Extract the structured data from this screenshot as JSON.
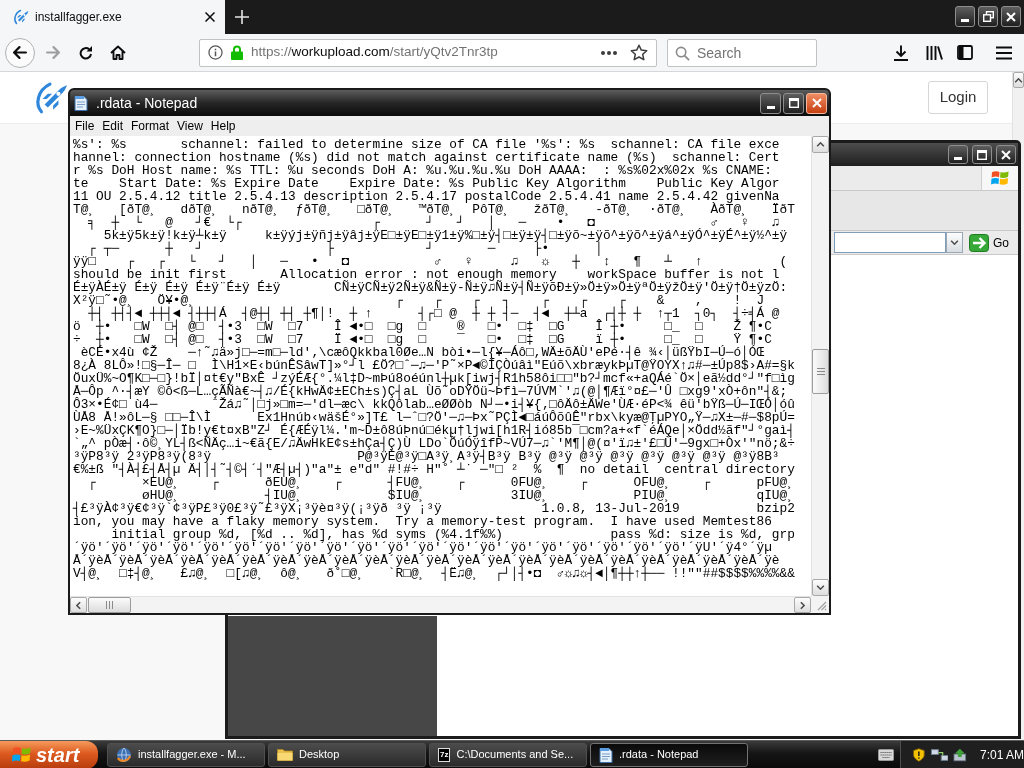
{
  "browser": {
    "tabs": [
      {
        "title": "installfagger.exe",
        "selected": true
      }
    ],
    "address": {
      "scheme": "https://",
      "host": "workupload.com",
      "path": "/start/yQtv2Tnr3tp"
    },
    "search": {
      "placeholder": "Search"
    }
  },
  "page": {
    "login_button": "Login"
  },
  "background_window": {
    "go_button": "Go"
  },
  "notepad": {
    "title": ".rdata - Notepad",
    "menu": [
      "File",
      "Edit",
      "Format",
      "View",
      "Help"
    ],
    "lines": [
      "%s': %s       schannel: failed to determine size of CA file '%s': %s  schannel: CA file exce",
      "hannel: connection hostname (%s) did not match against certificate name (%s)  schannel: Cert",
      "r %s DoH Host name: %s TTL: %u seconds DoH A: %u.%u.%u.%u DoH AAAA:  : %s%02x%02x %s CNAME:",
      "te    Start Date: %s Expire Date    Expire Date: %s Public Key Algorithm    Public Key Algor",
      "11 OU 2.5.4.12 title 2.5.4.13 description 2.5.4.17 postalCode 2.5.4.41 name 2.5.4.42 givenNa",
      "T@¸   [ðT@¸   dðT@¸   nðT@¸  ƒðT@¸   □ðT@¸   ™ðT@¸  PôT@¸   žðT@¸   -ðT@¸  ·ðT@¸   ÀðT@¸   ÏðT",
      "  ╕  ┼  └   @   ┘€  └┌                 ┌      ┘   ┘   │   ─    •   ◘               ♂   ♀   ♫",
      "    5k±ÿ5k±ÿ!k±ÿ┴k±ÿ     k±ÿýj±ÿñj±ÿâj±ÿE□±ÿE□±ÿ1±ÿ%□±ÿ┤□±ÿ±ÿ┤□±ÿõ~±ÿõ^±ÿõ^±ÿá^±ÿÓ^±ÿÉ^±ÿ½^±ÿ",
      "  ┌ ┬─      ┼   ┘                ├            ┘       ─     ├•      │",
      "ÿÿ□    ┌   ┌   └   ┘   │   ─   •   ◘           ♂   ♀     ♫   ☼   ┼   ↕   ¶   ┴   ↑          (",
      "should be init first       Allocation error : not enough memory    workSpace buffer is not l",
      "É±ÿÀÉ±ÿ É±ÿ É±ÿ É±ÿ¨É±ÿ É±ÿ       CÑ±ÿCÑ±ÿ2Ñ±ÿ&Ñ±ÿ-Ñ±ÿ♫Ñ±ÿ┤Ñ±ÿõÐ±ÿ»Ö±ÿ»Ö±ÿªÖ±ÿžÖ±ÿ'Ö±ÿ†Ö±ÿzÖ:",
      "X²ÿ□˜•@¸   Ö¥•@¸                          ┌    ┌    ┌   ┐    ┌    ┌    ┌    &    ,    !  J",
      "  ┼┤ ┼┤┤◄ ┼┼┤◄ ┤┼┼┤Á  ┤@┼┤ ┼┤ ┼¶│!  ┼ ↑      ┤┌□ @  ┼ ┼ ┤─  ┤◄  ┼┴a  ┌┤┼ ┼  ↑┬1  ┐0┐  ┤÷╡Á @",
      "ö  ┼•   □W  □┤ @□  ┤•3  □W  □7    Î ◄•□  □g  □    ®   □•  □‡  □G    Î ┼•     □_  □    Ž ¶•C",
      "÷  ┼•   □W  □┤ @□  ┤•3  □W  □7    Ï ◄•□  □g  □    ‾   □•  □‡  □G    ï ┼•     □_  □    Ÿ ¶•C",
      " èCÉ•x4ù ¢Ž    ─↑˜♫ä»j□─=m□─ld'‚\\cæôQkkbal0Øe…N bòi•─l{¥─Áô□,WÄ±õÄÙ'ePé·┤ê ¾‹│üßŸbI─Ú─ó│ÓŒ",
      "8¿À 8LÔ»!□§─Î─ □  Ì\\H1×E‹búnÊSâwT]»°┘l £Ö?□ˆ─♫─'P˜×P◄©ÌÇÒúâì\"Eúõ\\xbræykÞµT@ŸOYX↑♫#─±Úp8$›A#=§k",
      "ÖuxÜ%~O¶K□─□}!bÏ│¤t€y\"BxÊ ┘zýÉÆ{°.¼l‡D~mÞú8oéúnl┼µk[iwj┤R1h58ôi□□\"b?┘mcf«+aQÁé`Ö×│eã½dd°┘\"f□ìg",
      "Å─Ôp ^·┤æY ©ô<ß─L…çÃÑà€~┤♫/É{kHwÄ¢±ECh±s)Ç┤aL Ùõ˜oDŸÖü~Þfì─7ÚVM`'♫(@│¶Æï°¤£─'Û □xg9'xÒ+ôn\"┤&;",
      "Ô3×•É¢□ ù4─       ˆŽá♫˜│□j»□m=─'dl─æc\\ kkQôlab…eØØòb N┘─•i┤¥{‚□ôÄô±ÄWe'ÙÆ·éP<¾ êü'bŸß─Ú─IŒÓ│óû",
      "ÙÅ8 Å!»ôL─§ □□─Î\\Ì      Ex1Hnúb‹wäšÉ°»]T£ l─ˆ□?Ö'─♫─Þx˜PÇÌ◄□áúÔõûÊ\"rbx\\kyæ@ŢµPYO„Ÿ─♫X±─#─$8pÚ=",
      "›E~%ÜxÇK¶O}□─│Ïb!y€t¤xB\"Z┘ É{ÆÉÿl¼.'m~D±ô8úÞnú□ékµ†ljwi[h1R┤ió85b¯□cm?a+«f`éÁQe│×Ödd½ãf\"┘°gaì┤",
      "`„^ pÒæ┤·ô©¸YL┤ß<ÑÄç…i~€ã{E/♫ÄwHkE¢s±hÇa┤Ç)Ù LDo`ÕúÓÿîfP~VÚ7─♫`'M¶│@(¤'ï♫±'£□Ù'─9gx□+Òx'\"nö;&÷",
      "³ÿP8³ÿ 2³ÿP8³ÿ(8³ÿ                   P@³ÿÈ@³ÿ□A³ÿ¸A³ÿ┤B³ÿ B³ÿ @³ÿ @³ÿ @³ÿ @³ÿ @³ÿ @³ÿ @³ÿ8B³",
      "€%±ß \"┤À┤£┤Å┤µ Ä┤│┤˜┤©┤´┤\"Æ┤µ┤)\"a\"± e\"d\" #!#÷ H\"˚ ┴˙ ─\"□ ²  %  ¶  no detail  central directory",
      "  ┌      ×EU@¸    ┌      ðEU@¸    ┌      ┤FU@¸    ┌      0FU@¸    ┌      OFU@¸    ┌      pFU@¸",
      "         øHU@¸           ┤IU@¸           $IU@¸           3IU@¸           PIU@¸           qIU@¸",
      "┤£³ÿÀ¢³ÿ€¢³ÿ`¢³ÿP£³ÿ0£³ÿ˜£³ÿX¡³ÿè¤³ÿ(¡³ÿð ³ÿ ¡³ÿ             1.0.8, 13-Jul-2019          bzip2",
      "ion, you may have a flaky memory system.  Try a memory-test program.  I have used Memtest86",
      "     initial group %d, [%d .. %d], has %d syms (%4.1f%%)              pass %d: size is %d, grp",
      "´ÿö'´ÿö'´ÿö'´ÿö'´ÿö'´ÿö'´ÿö'´ÿö'´ÿö'´ÿö'´ÿö'´ÿö'´ÿö'´ÿö'´ÿö'´ÿö'´ÿö'´ÿö'´ÿö'´ÿö'´ÿU'´ÿ4°´ÿµ",
      "Å´ÿèÅ´ÿèÅ´ÿèÅ´ÿèÅ´ÿèÅ´ÿèÅ´ÿèÅ´ÿèÅ´ÿèÅ´ÿèÅ´ÿèÅ´ÿèÅ´ÿèÅ´ÿèÅ´ÿèÅ´ÿèÅ´ÿèÅ´ÿèÅ´ÿèÅ´ÿèÅ´ÿèÅ´ÿèÅ´ÿè",
      "V┤@¸  □‡┤@¸   £♫@¸  □[♫@¸  ô@¸   ð˚□@¸   `R□@¸  ┤Ë♫@¸  ┌┘│┤•◘  ♂☼♫☼┤◄│¶┼┼↑┼── !!\"\"##$$$$%%%%&&"
    ]
  },
  "taskbar": {
    "start_button": "start",
    "tasks": [
      {
        "label": "installfagger.exe - M...",
        "kind": "browser",
        "selected": false
      },
      {
        "label": "Desktop",
        "kind": "folder",
        "selected": false
      },
      {
        "label": "C:\\Documents and Se...",
        "kind": "archive",
        "badge": "7z",
        "selected": false
      },
      {
        "label": ".rdata - Notepad",
        "kind": "notepad",
        "selected": true
      }
    ],
    "clock": "7:01 AM"
  }
}
